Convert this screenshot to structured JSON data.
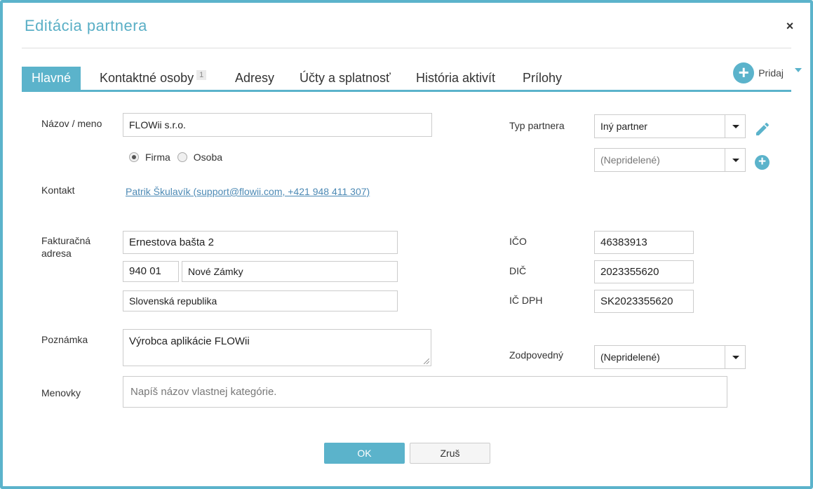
{
  "dialog": {
    "title": "Editácia partnera",
    "close_glyph": "×"
  },
  "tabs": [
    {
      "label": "Hlavné",
      "active": true
    },
    {
      "label": "Kontaktné osoby",
      "badge": "1"
    },
    {
      "label": "Adresy"
    },
    {
      "label": "Účty a splatnosť"
    },
    {
      "label": "História aktivít"
    },
    {
      "label": "Prílohy"
    }
  ],
  "add_menu": {
    "label": "Pridaj",
    "icon": "plus-icon"
  },
  "form": {
    "name": {
      "label": "Názov / meno",
      "value": "FLOWii s.r.o."
    },
    "entity_type": {
      "options": [
        "Firma",
        "Osoba"
      ],
      "selected": "Firma"
    },
    "contact": {
      "label": "Kontakt",
      "value": "Patrik Škulavík (support@flowii.com, +421 948 411 307)"
    },
    "billing_address": {
      "label_line1": "Fakturačná",
      "label_line2": "adresa",
      "street": "Ernestova bašta 2",
      "zip": "940 01",
      "city": "Nové Zámky",
      "country": "Slovenská republika"
    },
    "note": {
      "label": "Poznámka",
      "value": "Výrobca aplikácie FLOWii"
    },
    "tags": {
      "label": "Menovky",
      "placeholder": "Napíš názov vlastnej kategórie."
    },
    "partner_type": {
      "label": "Typ partnera",
      "value": "Iný partner",
      "secondary_value": "(Nepridelené)"
    },
    "ico": {
      "label": "IČO",
      "value": "46383913"
    },
    "dic": {
      "label": "DIČ",
      "value": "2023355620"
    },
    "ic_dph": {
      "label": "IČ DPH",
      "value": "SK2023355620"
    },
    "responsible": {
      "label": "Zodpovedný",
      "value": "(Nepridelené)"
    }
  },
  "footer": {
    "ok_label": "OK",
    "cancel_label": "Zruš"
  },
  "colors": {
    "accent": "#5bb3cb",
    "link": "#4d8ab5"
  }
}
